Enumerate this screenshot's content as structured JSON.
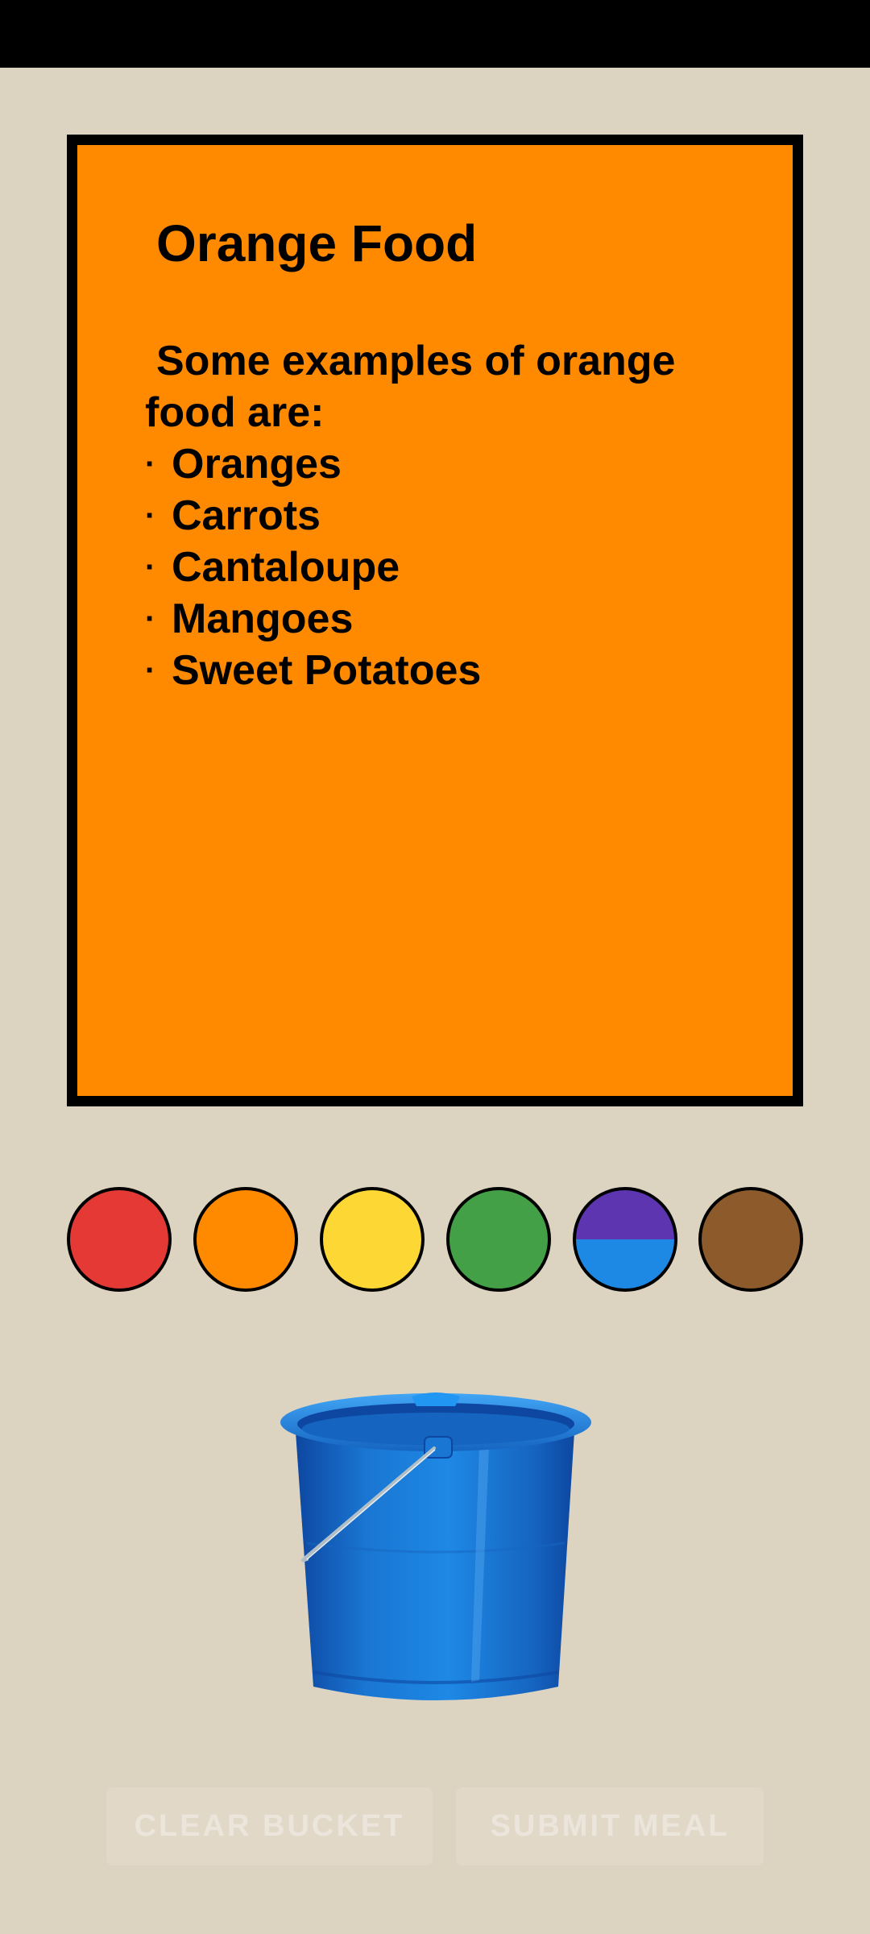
{
  "card": {
    "title": "Orange Food",
    "intro": "Some examples of orange food are:",
    "items": [
      "Oranges",
      "Carrots",
      "Cantaloupe",
      "Mangoes",
      "Sweet Potatoes"
    ],
    "bullet": "·",
    "background": "#FF8A00"
  },
  "color_buttons": [
    {
      "name": "red",
      "colors": [
        "#E53935"
      ]
    },
    {
      "name": "orange",
      "colors": [
        "#FF8A00"
      ]
    },
    {
      "name": "yellow",
      "colors": [
        "#FDD835"
      ]
    },
    {
      "name": "green",
      "colors": [
        "#43A047"
      ]
    },
    {
      "name": "purple-blue",
      "colors": [
        "#5E35B1",
        "#1E88E5"
      ]
    },
    {
      "name": "brown",
      "colors": [
        "#8D5A2B"
      ]
    }
  ],
  "bucket": {
    "icon": "bucket-icon",
    "color": "#1565C0"
  },
  "buttons": {
    "clear": "CLEAR BUCKET",
    "submit": "SUBMIT MEAL"
  },
  "theme": {
    "page_background": "#DDD3C1",
    "status_bar": "#000000"
  }
}
